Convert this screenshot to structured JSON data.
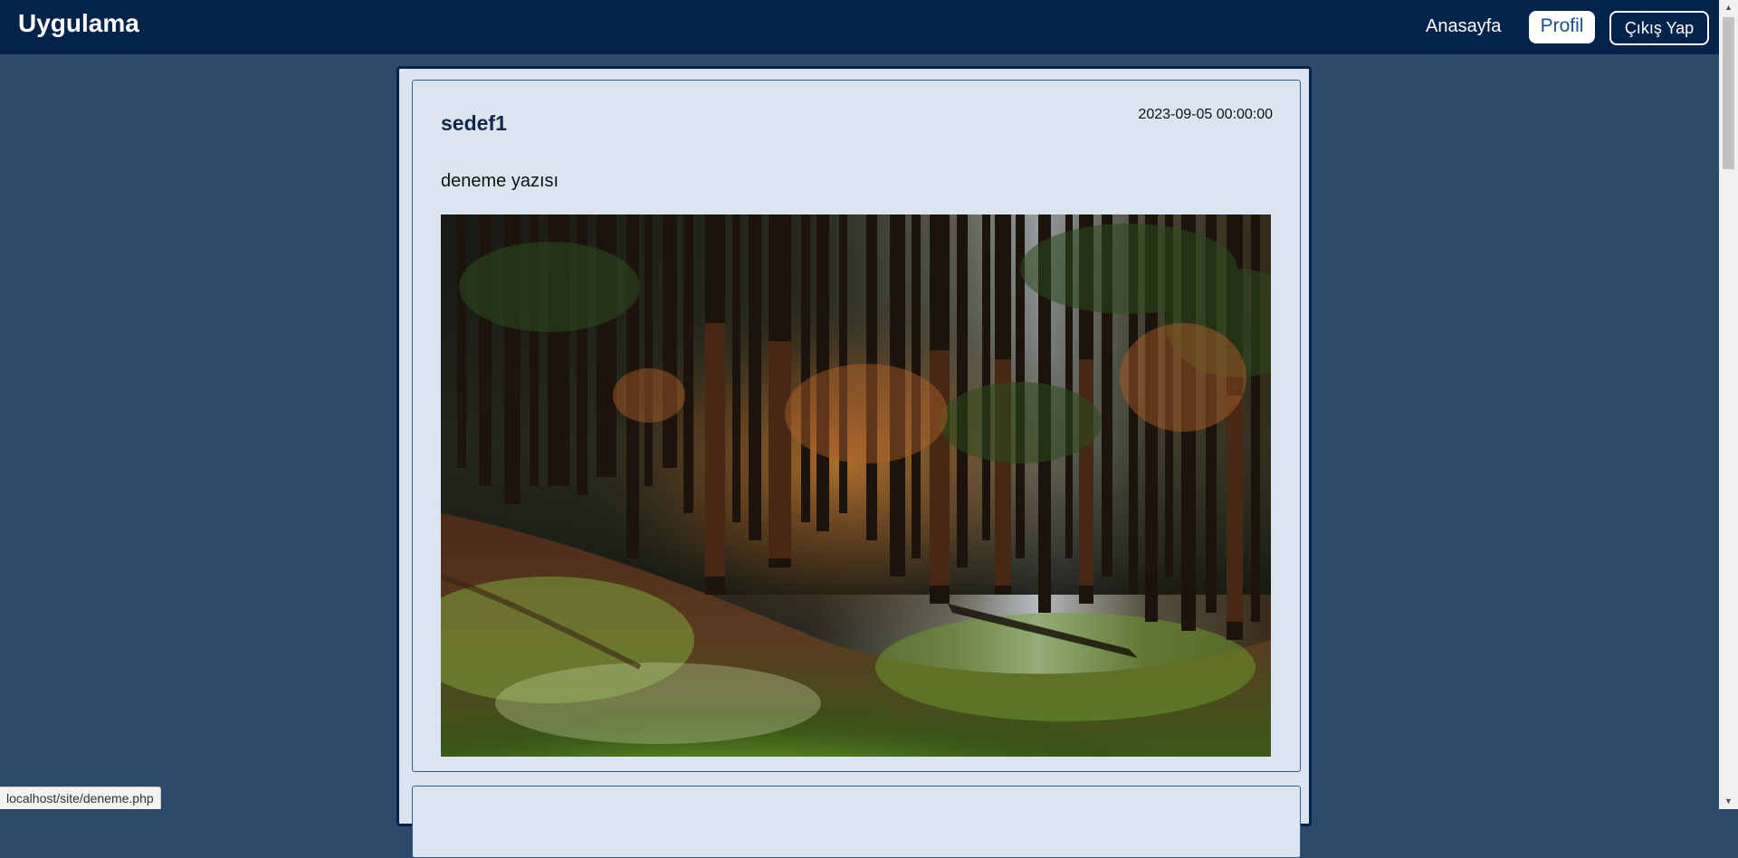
{
  "navbar": {
    "brand": "Uygulama",
    "links": {
      "home": "Anasayfa",
      "profile": "Profil",
      "logout": "Çıkış Yap"
    }
  },
  "feed": {
    "posts": [
      {
        "author": "sedef1",
        "date": "2023-09-05 00:00:00",
        "text": "deneme yazısı",
        "image": "forest-photo"
      }
    ]
  },
  "status_bar": {
    "url": "localhost/site/deneme.php"
  },
  "colors": {
    "page_background": "#2e4a6b",
    "navbar": "#03234a",
    "card_background": "#dbe5f1",
    "card_border": "#3b5e86"
  },
  "icons": {
    "scroll_up": "triangle-up",
    "scroll_down": "triangle-down"
  }
}
